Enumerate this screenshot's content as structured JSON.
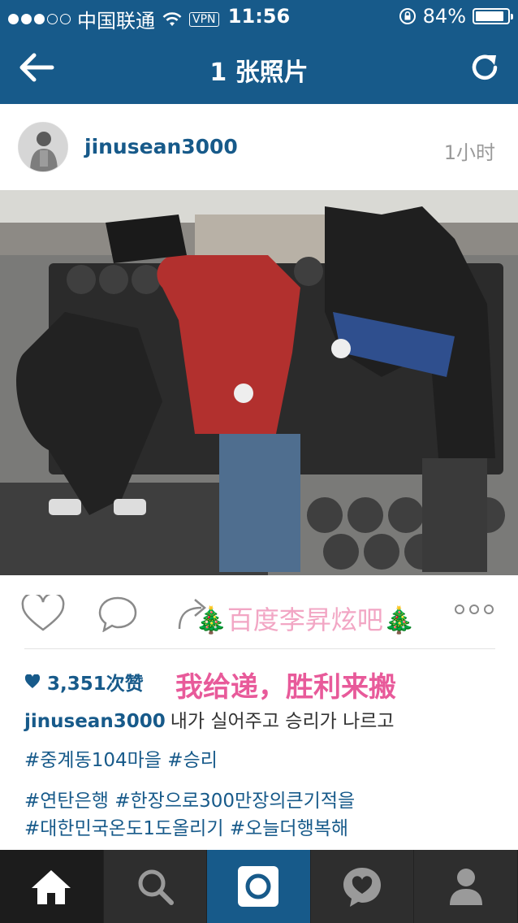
{
  "status_bar": {
    "carrier": "中国联通",
    "vpn": "VPN",
    "time": "11:56",
    "battery": "84%"
  },
  "nav": {
    "title": "1 张照片",
    "back_icon": "arrow-left-icon",
    "refresh_icon": "refresh-icon"
  },
  "post": {
    "username": "jinusean3000",
    "time_ago": "1小时",
    "likes": "3,351次赞",
    "watermark": "百度李昇炫吧",
    "overlay_text": "我给递，胜利来搬",
    "caption_user": "jinusean3000",
    "caption_text": "내가 실어주고 승리가 나르고",
    "tags_line1": "#중계동104마을 #승리",
    "tags_line2": "#연탄은행 #한장으로300만장의큰기적을",
    "tags_line3": "#대한민국온도1도올리기 #오늘더행복해"
  },
  "tabbar": {
    "items": [
      "home-icon",
      "search-icon",
      "camera-icon",
      "activity-heart-icon",
      "profile-icon"
    ]
  },
  "colors": {
    "brand": "#175a8a",
    "tab_bg": "#2e2e2e",
    "overlay_pink": "#e85a9a"
  }
}
